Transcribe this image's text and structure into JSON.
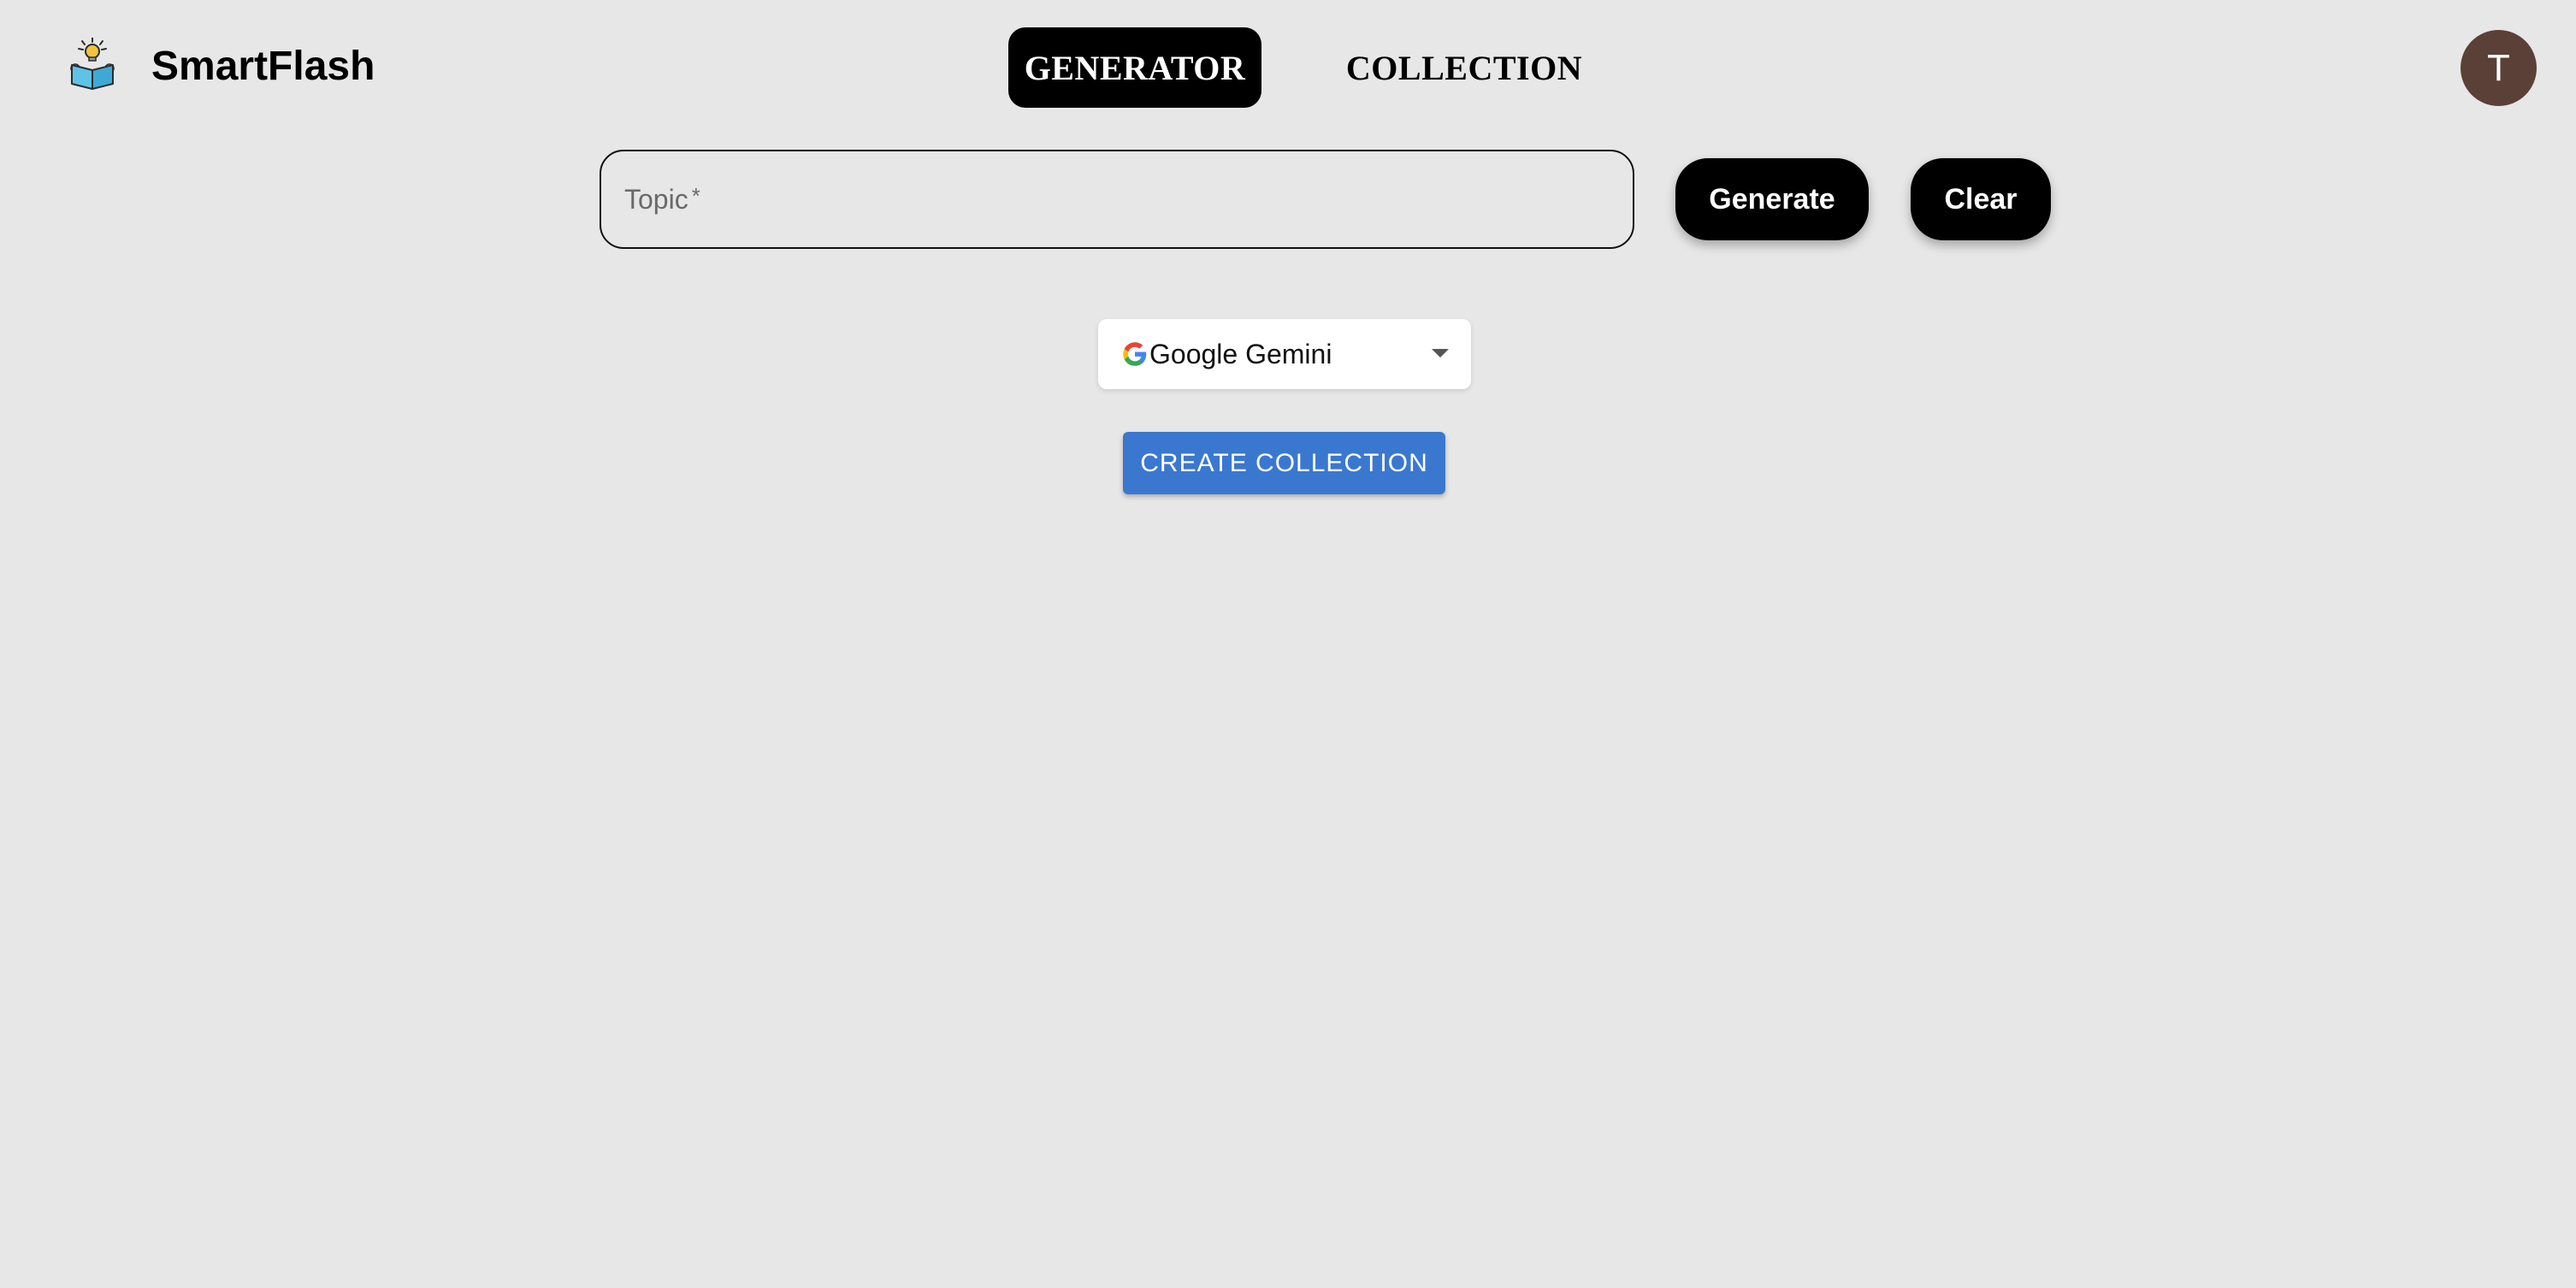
{
  "app": {
    "name": "SmartFlash",
    "logo_icon": "reading-book-lightbulb-icon"
  },
  "nav": {
    "tabs": [
      {
        "label": "GENERATOR",
        "active": true
      },
      {
        "label": "COLLECTION",
        "active": false
      }
    ]
  },
  "user": {
    "avatar_initial": "T",
    "avatar_color": "#5a4037"
  },
  "topic": {
    "label": "Topic",
    "required_mark": "*",
    "value": ""
  },
  "actions": {
    "generate_label": "Generate",
    "clear_label": "Clear"
  },
  "model_select": {
    "icon": "google-g-icon",
    "selected": "Google Gemini"
  },
  "create_collection": {
    "label": "CREATE COLLECTION",
    "color": "#3a78d0"
  },
  "colors": {
    "background": "#e7e7e7",
    "primary_button": "#000000"
  }
}
